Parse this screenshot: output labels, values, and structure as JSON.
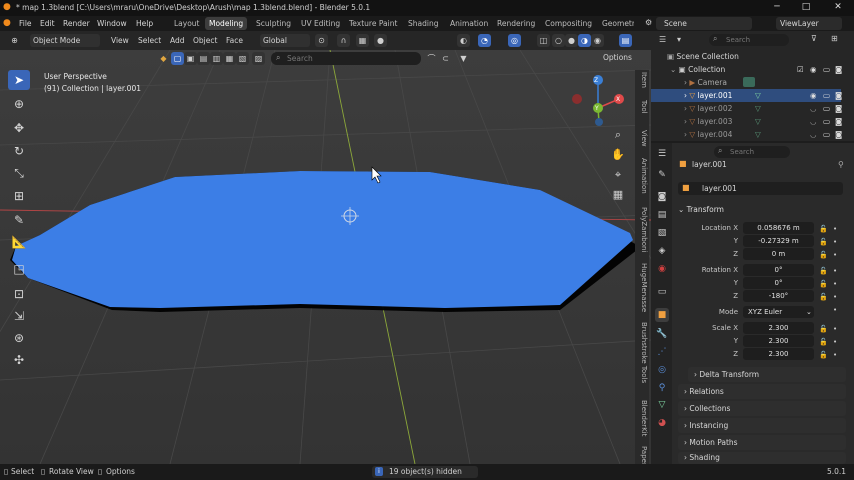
{
  "titlebar": {
    "title": "* map 1.3blend [C:\\Users\\mraru\\OneDrive\\Desktop\\Arush\\map 1.3blend.blend] - Blender 5.0.1",
    "minimize": "─",
    "maximize": "□",
    "close": "✕"
  },
  "menubar": {
    "menus": [
      "File",
      "Edit",
      "Render",
      "Window",
      "Help"
    ],
    "workspaces": [
      "Layout",
      "Modeling",
      "Sculpting",
      "UV Editing",
      "Texture Paint",
      "Shading",
      "Animation",
      "Rendering",
      "Compositing",
      "Geometr"
    ],
    "active_workspace": "Modeling",
    "scene": "Scene",
    "view_layer": "ViewLayer"
  },
  "viewport_header": {
    "mode": "Object Mode",
    "menus": [
      "View",
      "Select",
      "Add",
      "Object",
      "Face"
    ],
    "orientation": "Global",
    "search_placeholder": "Search",
    "options": "Options"
  },
  "viewport": {
    "perspective": "User Perspective",
    "collection_info": "(91) Collection | layer.001",
    "n_tabs": [
      "Item",
      "Tool",
      "View",
      "Animation",
      "PolyZamboni",
      "HugeMenasse",
      "Brushstroke Tools",
      "BlenderKit",
      "Paper"
    ],
    "gizmo_labels": {
      "x": "X",
      "y": "Y",
      "z": "Z"
    },
    "mesh_color": "#3c7ee6"
  },
  "outliner": {
    "search_placeholder": "Search",
    "items": [
      {
        "label": "Scene Collection",
        "depth": 0
      },
      {
        "label": "Collection",
        "depth": 1
      },
      {
        "label": "Camera",
        "depth": 2
      },
      {
        "label": "layer.001",
        "depth": 2,
        "selected": true
      },
      {
        "label": "layer.002",
        "depth": 2
      },
      {
        "label": "layer.003",
        "depth": 2
      },
      {
        "label": "layer.004",
        "depth": 2
      }
    ]
  },
  "properties": {
    "search_placeholder": "Search",
    "object_name": "layer.001",
    "data_name": "layer.001",
    "transform_title": "Transform",
    "location_label": "Location X",
    "location": {
      "x": "0.058676 m",
      "y": "-0.27329 m",
      "z": "0 m"
    },
    "rotation_label": "Rotation X",
    "rotation": {
      "x": "0°",
      "y": "0°",
      "z": "-180°"
    },
    "mode_label": "Mode",
    "mode_value": "XYZ Euler",
    "scale_label": "Scale X",
    "scale": {
      "x": "2.300",
      "y": "2.300",
      "z": "2.300"
    },
    "axis_y": "Y",
    "axis_z": "Z",
    "sections": [
      "Delta Transform",
      "Relations",
      "Collections",
      "Instancing",
      "Motion Paths",
      "Shading"
    ]
  },
  "statusbar": {
    "select": "Select",
    "rotate_view": "Rotate View",
    "options": "Options",
    "hidden_info": "19 object(s) hidden",
    "version": "5.0.1"
  },
  "colors": {
    "accent": "#3a66b8",
    "selection": "#2f4d7e",
    "axis_x": "#e04a4a",
    "axis_y": "#7bb832",
    "axis_z": "#3a7fd6"
  }
}
